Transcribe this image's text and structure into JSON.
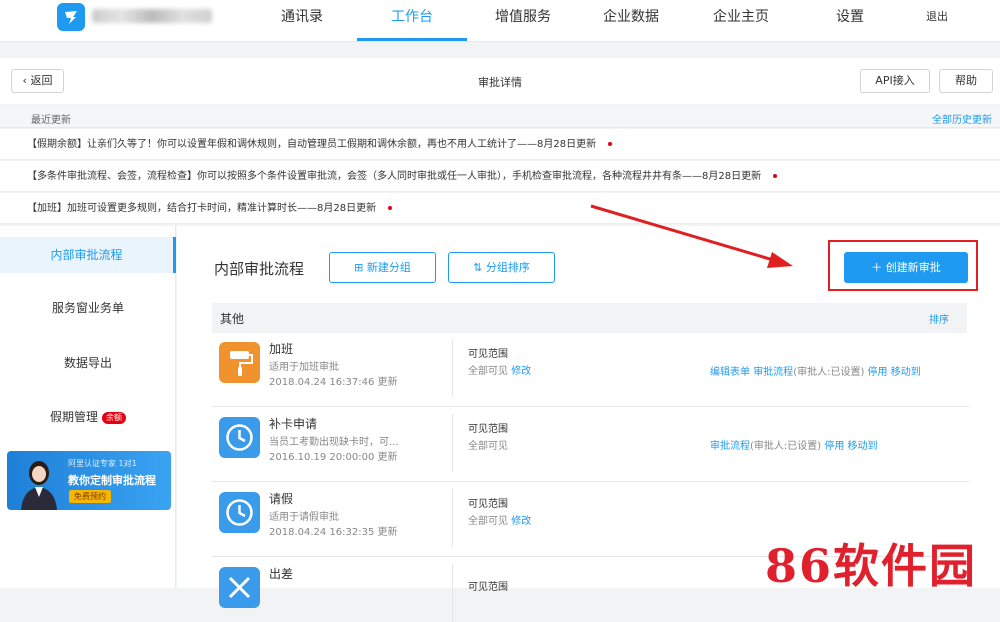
{
  "nav": {
    "items": [
      "通讯录",
      "工作台",
      "增值服务",
      "企业数据",
      "企业主页",
      "设置"
    ],
    "active": "工作台",
    "logout": "退出"
  },
  "header": {
    "back": "返回",
    "title": "审批详情",
    "api": "API接入",
    "help": "帮助"
  },
  "updates": {
    "label": "最近更新",
    "all_history": "全部历史更新",
    "notices": [
      "【假期余额】让亲们久等了！你可以设置年假和调休规则，自动管理员工假期和调休余额，再也不用人工统计了——8月28日更新",
      "【多条件审批流程、会签，流程检查】你可以按照多个条件设置审批流，会签（多人同时审批或任一人审批），手机检查审批流程，各种流程井井有条——8月28日更新",
      "【加班】加班可设置更多规则，结合打卡时间，精准计算时长——8月28日更新"
    ]
  },
  "sidebar": {
    "items": [
      {
        "label": "内部审批流程"
      },
      {
        "label": "服务窗业务单"
      },
      {
        "label": "数据导出"
      },
      {
        "label": "假期管理",
        "badge": "余额"
      }
    ],
    "promo": {
      "line1": "阿里认证专家 1对1",
      "line2": "教你定制审批流程",
      "button": "免费预约"
    }
  },
  "main": {
    "title": "内部审批流程",
    "new_group": "新建分组",
    "sort_groups": "分组排序",
    "create": "创建新审批",
    "group": {
      "name": "其他",
      "sort": "排序"
    },
    "rows": [
      {
        "name": "加班",
        "desc": "适用于加班审批",
        "time": "2018.04.24 16:37:46 更新",
        "vis_label": "可见范围",
        "vis_value": "全部可见",
        "vis_edit": "修改",
        "actions": [
          "编辑表单",
          "审批流程",
          "(审批人:已设置)",
          "停用",
          "移动到"
        ]
      },
      {
        "name": "补卡申请",
        "desc": "当员工考勤出现缺卡时，可...",
        "time": "2016.10.19 20:00:00 更新",
        "vis_label": "可见范围",
        "vis_value": "全部可见",
        "vis_edit": "",
        "actions": [
          "审批流程",
          "(审批人:已设置)",
          "停用",
          "移动到"
        ]
      },
      {
        "name": "请假",
        "desc": "适用于请假审批",
        "time": "2018.04.24 16:32:35 更新",
        "vis_label": "可见范围",
        "vis_value": "全部可见",
        "vis_edit": "修改",
        "actions": []
      },
      {
        "name": "出差",
        "desc": "",
        "time": "",
        "vis_label": "可见范围",
        "vis_value": "",
        "vis_edit": "",
        "actions": []
      }
    ]
  },
  "watermark": "86软件园",
  "colors": {
    "accent": "#1e9bf0",
    "highlight": "#e02020",
    "overtime_icon": "#f0922e",
    "clock_icon": "#3a9bea"
  }
}
